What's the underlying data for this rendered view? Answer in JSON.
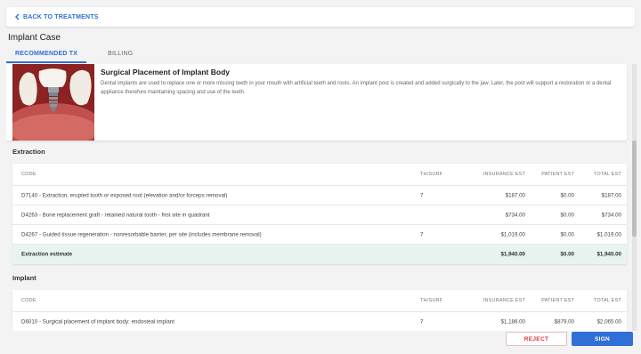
{
  "topbar": {
    "back_label": "BACK TO TREATMENTS"
  },
  "page_title": "Implant Case",
  "tabs": [
    {
      "label": "RECOMMENDED TX",
      "active": true
    },
    {
      "label": "BILLING",
      "active": false
    }
  ],
  "treatment": {
    "title": "Surgical Placement of Implant Body",
    "description": "Dental implants are used to replace one or more missing teeth in your mouth with artificial teeth and roots. An implant post is created and added surgically to the jaw. Later, the post will support a restoration or a dental appliance therefore maintaining spacing and use of the teeth."
  },
  "columns": {
    "code": "CODE",
    "th_surf": "TH/SURF",
    "insurance_est": "INSURANCE EST",
    "patient_est": "PATIENT EST",
    "total_est": "TOTAL EST"
  },
  "extraction": {
    "title": "Extraction",
    "rows": [
      {
        "code": "D7140 - Extraction, erupted tooth or exposed root (elevation and/or forceps removal)",
        "th_surf": "7",
        "insurance": "$187.00",
        "patient": "$0.00",
        "total": "$187.00"
      },
      {
        "code": "D4263 - Bone replacement graft - retained natural tooth - first site in quadrant",
        "th_surf": "",
        "insurance": "$734.00",
        "patient": "$0.00",
        "total": "$734.00"
      },
      {
        "code": "D4267 - Guided tissue regeneration - nonresorbable barrier, per site (includes membrane removal)",
        "th_surf": "7",
        "insurance": "$1,019.00",
        "patient": "$0.00",
        "total": "$1,019.00"
      }
    ],
    "estimate": {
      "label": "Extraction estimate",
      "insurance": "$1,940.00",
      "patient": "$0.00",
      "total": "$1,940.00"
    }
  },
  "implant": {
    "title": "Implant",
    "rows": [
      {
        "code": "D6010 - Surgical placement of implant body: endosteal implant",
        "th_surf": "7",
        "insurance": "$1,186.00",
        "patient": "$879.00",
        "total": "$2,065.00"
      }
    ]
  },
  "actions": {
    "reject_label": "REJECT",
    "sign_label": "SIGN"
  },
  "colors": {
    "accent": "#2f6fd6",
    "reject": "#d9363e",
    "estimate_bg": "#e8f4ef"
  }
}
